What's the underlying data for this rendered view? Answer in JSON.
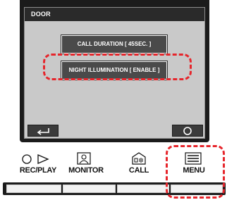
{
  "screen": {
    "title": "DOOR",
    "call_duration_label": "CALL DURATION      [ 45SEC. ]",
    "night_illumination_label": "NIGHT ILLUMINATION [ ENABLE ]",
    "back_icon": "return-arrow-icon",
    "ok_icon": "circle-icon"
  },
  "buttons": {
    "rec_play": "REC/PLAY",
    "monitor": "MONITOR",
    "call": "CALL",
    "menu": "MENU"
  },
  "colors": {
    "highlight": "#e6252b",
    "screen_bg": "#c9c9c9",
    "button_bg": "#4a4a4a"
  }
}
